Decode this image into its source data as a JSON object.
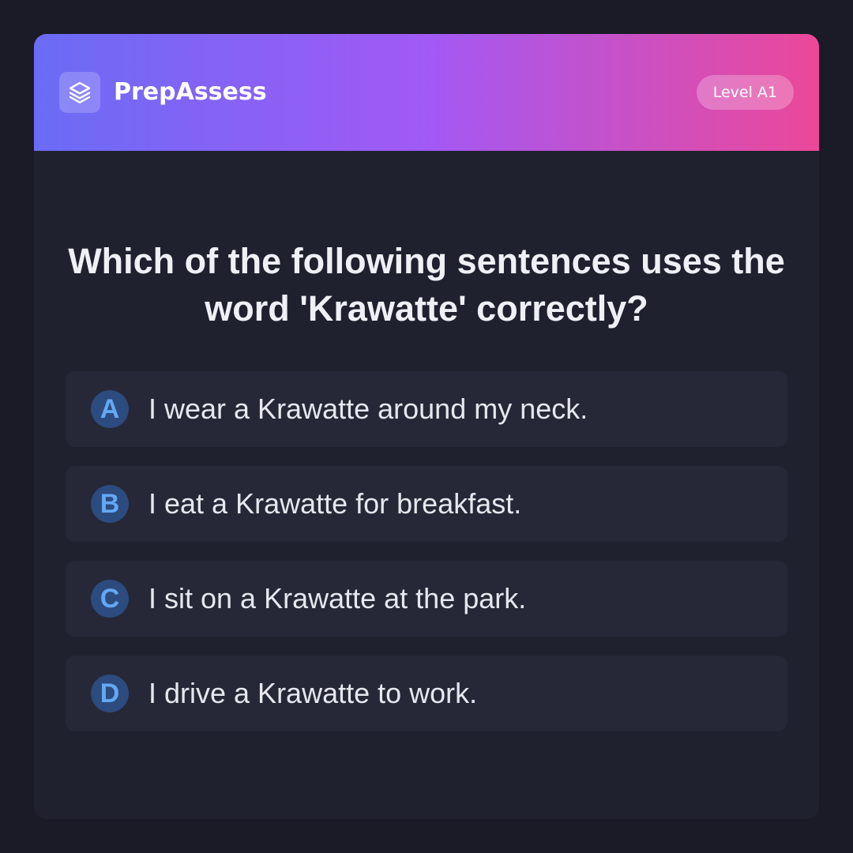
{
  "header": {
    "logo_icon": "layers-icon",
    "brand": "PrepAssess",
    "level_badge": "Level A1",
    "gradient_colors": [
      "#6a6cf5",
      "#a259f5",
      "#ec4899"
    ]
  },
  "question": {
    "text": "Which of the following sentences uses the word 'Krawatte' correctly?"
  },
  "options": [
    {
      "letter": "A",
      "text": "I wear a Krawatte around my neck."
    },
    {
      "letter": "B",
      "text": "I eat a Krawatte for breakfast."
    },
    {
      "letter": "C",
      "text": "I sit on a Krawatte at the park."
    },
    {
      "letter": "D",
      "text": "I drive a Krawatte to work."
    }
  ],
  "colors": {
    "page_background": "#1a1b26",
    "card_background": "#1f212e",
    "option_background": "#262837",
    "letter_badge_background": "#2c4b7e",
    "letter_color": "#63a8f5"
  }
}
